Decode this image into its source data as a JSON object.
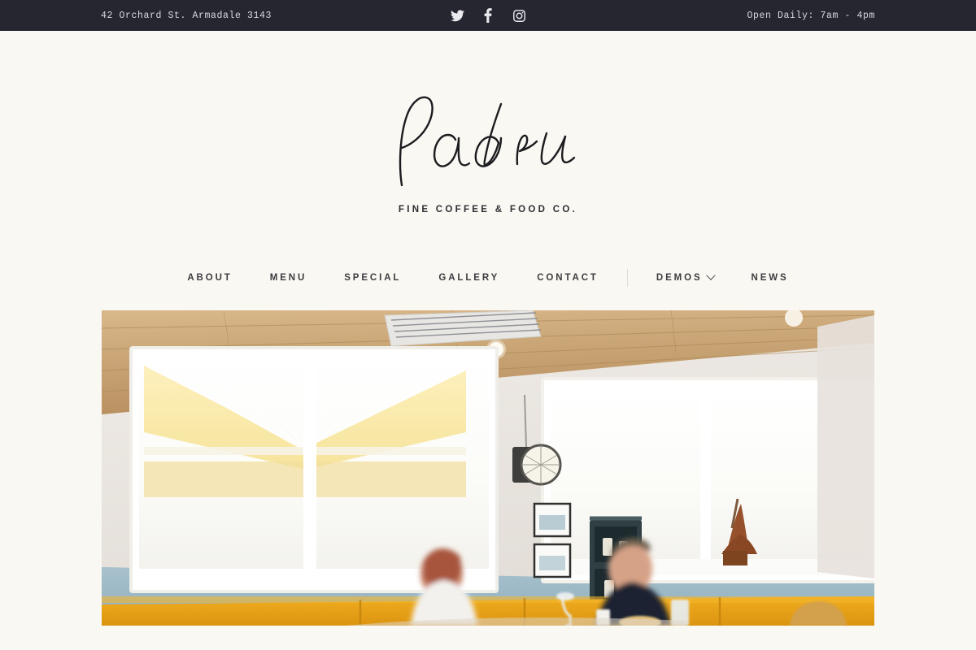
{
  "topbar": {
    "address": "42 Orchard St. Armadale 3143",
    "hours": "Open Daily: 7am - 4pm",
    "background_color": "#262631",
    "text_color": "#d8d8dc",
    "social": [
      {
        "name": "twitter-icon",
        "label": "Twitter"
      },
      {
        "name": "facebook-icon",
        "label": "Facebook"
      },
      {
        "name": "instagram-icon",
        "label": "Instagram"
      }
    ]
  },
  "header": {
    "logo_text": "Padri",
    "tagline": "FINE COFFEE & FOOD CO.",
    "logo_color": "#1c1c20"
  },
  "nav": {
    "items": [
      {
        "label": "ABOUT",
        "has_dropdown": false
      },
      {
        "label": "MENU",
        "has_dropdown": false
      },
      {
        "label": "SPECIAL",
        "has_dropdown": false
      },
      {
        "label": "GALLERY",
        "has_dropdown": false
      },
      {
        "label": "CONTACT",
        "has_dropdown": false
      }
    ],
    "items_after_divider": [
      {
        "label": "DEMOS",
        "has_dropdown": true
      },
      {
        "label": "NEWS",
        "has_dropdown": false
      }
    ],
    "text_color": "#3c3c3f"
  },
  "hero": {
    "alt": "Restaurant interior with timber ceiling, large white windows, yellow banquette seating and diners at a table",
    "colors": {
      "wall": "#ece8e3",
      "wainscot": "#9bb6c4",
      "banquette": "#e8a317",
      "timber": "#c9a475",
      "window_light": "#fdfdfc"
    }
  },
  "page": {
    "background_color": "#faf8f3"
  }
}
